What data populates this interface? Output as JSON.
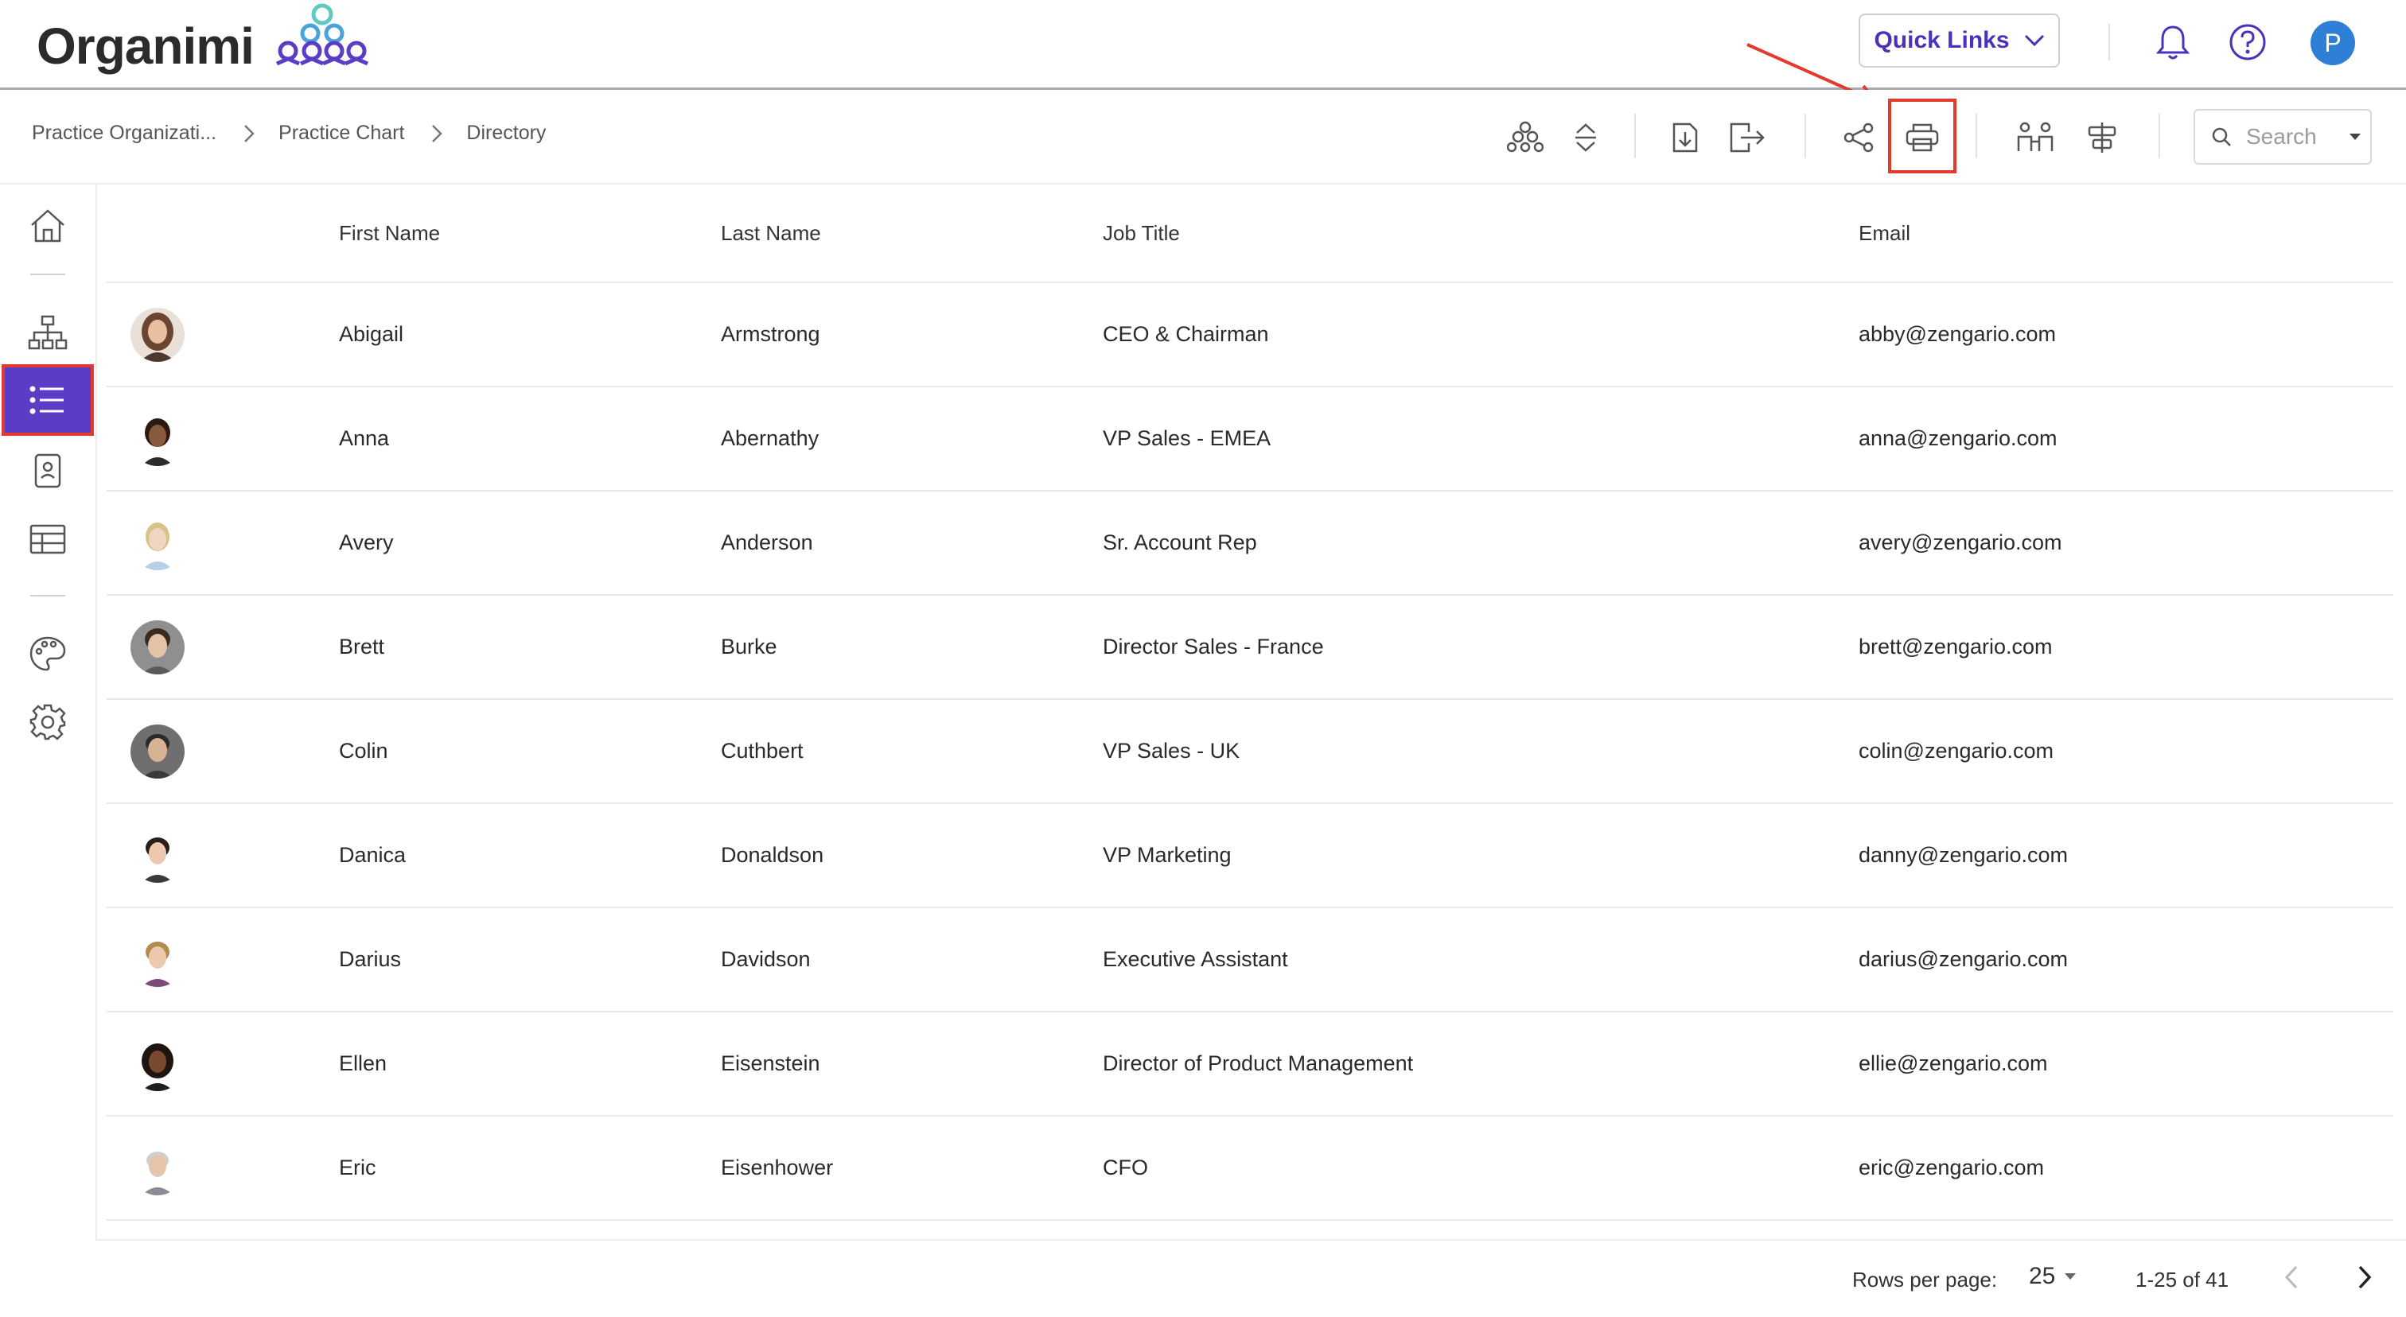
{
  "app": {
    "logo_text": "Organimi"
  },
  "header": {
    "quick_links_label": "Quick Links",
    "avatar_initial": "P"
  },
  "breadcrumbs": [
    "Practice Organizati...",
    "Practice Chart",
    "Directory"
  ],
  "search": {
    "placeholder": "Search"
  },
  "table": {
    "columns": [
      "First Name",
      "Last Name",
      "Job Title",
      "Email"
    ],
    "rows": [
      {
        "first": "Abigail",
        "last": "Armstrong",
        "job": "CEO & Chairman",
        "email": "abby@zengario.com"
      },
      {
        "first": "Anna",
        "last": "Abernathy",
        "job": "VP Sales - EMEA",
        "email": "anna@zengario.com"
      },
      {
        "first": "Avery",
        "last": "Anderson",
        "job": "Sr. Account Rep",
        "email": "avery@zengario.com"
      },
      {
        "first": "Brett",
        "last": "Burke",
        "job": "Director Sales - France",
        "email": "brett@zengario.com"
      },
      {
        "first": "Colin",
        "last": "Cuthbert",
        "job": "VP Sales - UK",
        "email": "colin@zengario.com"
      },
      {
        "first": "Danica",
        "last": "Donaldson",
        "job": "VP Marketing",
        "email": "danny@zengario.com"
      },
      {
        "first": "Darius",
        "last": "Davidson",
        "job": "Executive Assistant",
        "email": "darius@zengario.com"
      },
      {
        "first": "Ellen",
        "last": "Eisenstein",
        "job": "Director of Product Management",
        "email": "ellie@zengario.com"
      },
      {
        "first": "Eric",
        "last": "Eisenhower",
        "job": "CFO",
        "email": "eric@zengario.com"
      }
    ]
  },
  "pagination": {
    "rows_per_page_label": "Rows per page:",
    "rows_per_page": "25",
    "range": "1-25 of 41"
  },
  "colors": {
    "accent": "#5b3cc4",
    "link_text": "#4b32b8",
    "highlight": "#e23b2e",
    "avatar_bg": "#2f7fd6"
  }
}
